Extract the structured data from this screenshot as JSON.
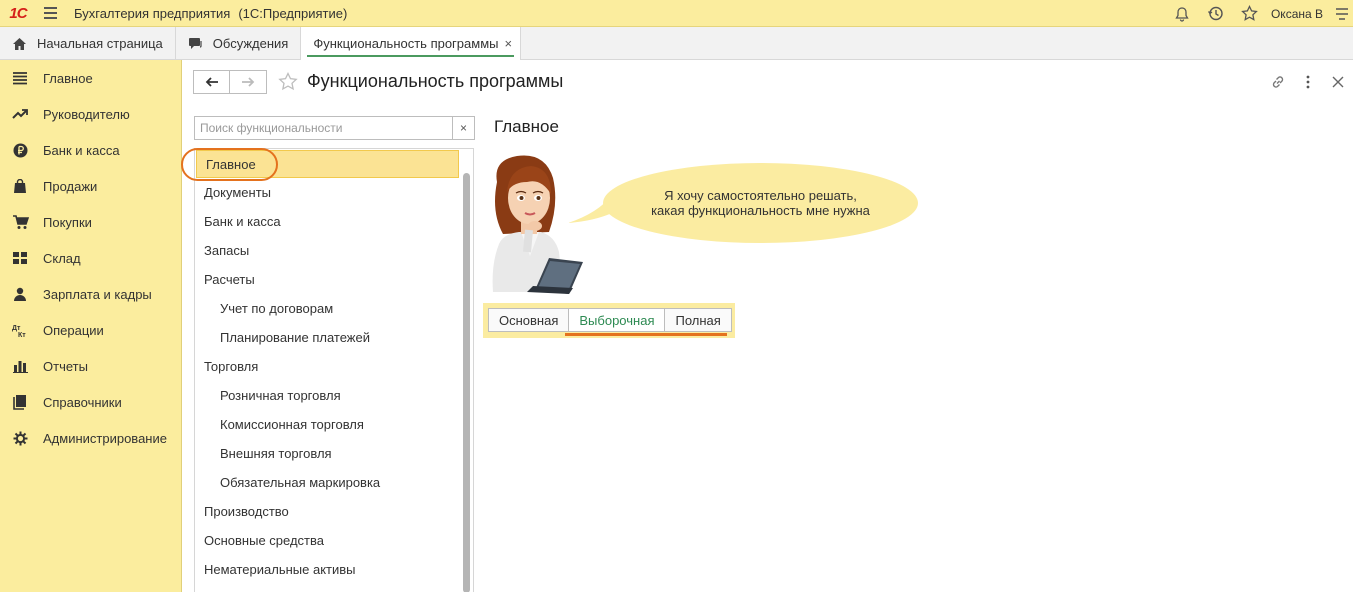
{
  "titlebar": {
    "logo": "1С",
    "app_name": "Бухгалтерия предприятия",
    "platform": "(1С:Предприятие)",
    "user_name": "Оксана В"
  },
  "tabs": [
    {
      "label": "Начальная страница",
      "icon": "home-icon"
    },
    {
      "label": "Обсуждения",
      "icon": "chat-icon"
    },
    {
      "label": "Функциональность программы",
      "active": true
    }
  ],
  "tab_close": "×",
  "sidebar": {
    "items": [
      {
        "label": "Главное",
        "icon": "menu-lines-icon"
      },
      {
        "label": "Руководителю",
        "icon": "trend-icon"
      },
      {
        "label": "Банк и касса",
        "icon": "ruble-icon"
      },
      {
        "label": "Продажи",
        "icon": "bag-icon"
      },
      {
        "label": "Покупки",
        "icon": "cart-icon"
      },
      {
        "label": "Склад",
        "icon": "warehouse-icon"
      },
      {
        "label": "Зарплата и кадры",
        "icon": "person-icon"
      },
      {
        "label": "Операции",
        "icon": "dt-kt-icon"
      },
      {
        "label": "Отчеты",
        "icon": "bar-chart-icon"
      },
      {
        "label": "Справочники",
        "icon": "book-icon"
      },
      {
        "label": "Администрирование",
        "icon": "gear-icon"
      }
    ]
  },
  "form": {
    "title": "Функциональность программы",
    "search_placeholder": "Поиск функциональности",
    "clear": "×",
    "panel_title": "Главное",
    "bubble_line1": "Я хочу самостоятельно решать,",
    "bubble_line2": "какая функциональность мне нужна",
    "modes": [
      "Основная",
      "Выборочная",
      "Полная"
    ],
    "active_mode": "Выборочная"
  },
  "sections": {
    "items": [
      {
        "label": "Главное",
        "level": 0,
        "selected": true
      },
      {
        "label": "Документы",
        "level": 0
      },
      {
        "label": "Банк и касса",
        "level": 0
      },
      {
        "label": "Запасы",
        "level": 0
      },
      {
        "label": "Расчеты",
        "level": 0
      },
      {
        "label": "Учет по договорам",
        "level": 1
      },
      {
        "label": "Планирование платежей",
        "level": 1
      },
      {
        "label": "Торговля",
        "level": 0
      },
      {
        "label": "Розничная торговля",
        "level": 1
      },
      {
        "label": "Комиссионная торговля",
        "level": 1
      },
      {
        "label": "Внешняя торговля",
        "level": 1
      },
      {
        "label": "Обязательная маркировка",
        "level": 1
      },
      {
        "label": "Производство",
        "level": 0
      },
      {
        "label": "Основные средства",
        "level": 0
      },
      {
        "label": "Нематериальные активы",
        "level": 0
      }
    ]
  },
  "colors": {
    "accent_yellow": "#fbed9e",
    "highlight_orange": "#e4721e",
    "active_green": "#2d8a52",
    "logo_red": "#d5211a"
  }
}
